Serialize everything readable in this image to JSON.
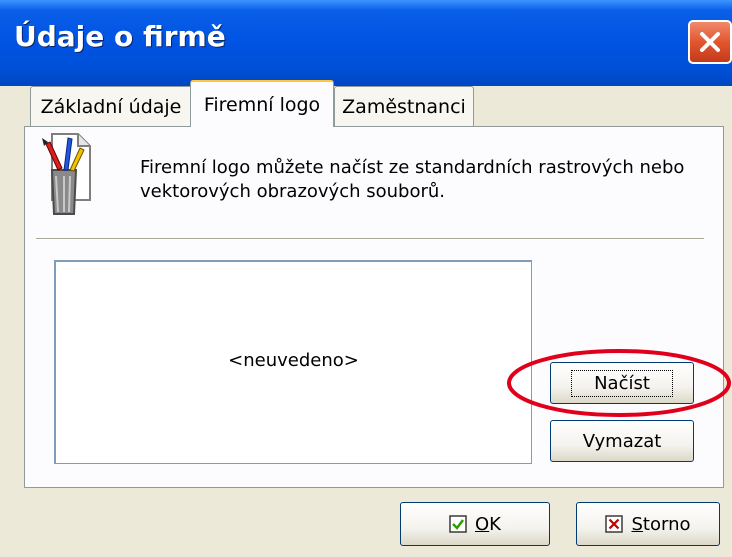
{
  "window": {
    "title": "Údaje o firmě",
    "close_icon": "close-icon"
  },
  "tabs": [
    {
      "label": "Základní údaje",
      "active": false
    },
    {
      "label": "Firemní logo",
      "active": true
    },
    {
      "label": "Zaměstnanci",
      "active": false
    }
  ],
  "panel": {
    "icon": "paint-tools-icon",
    "info_text": "Firemní logo můžete načíst ze standardních rastrových nebo vektorových obrazových souborů.",
    "logo_placeholder": "<neuvedeno>",
    "load_label": "Načíst",
    "clear_label": "Vymazat"
  },
  "footer": {
    "ok_mnemonic": "O",
    "ok_rest": "K",
    "cancel_mnemonic": "S",
    "cancel_rest": "torno"
  },
  "colors": {
    "titlebar": "#0054e3",
    "annotation": "#e0001b",
    "ok_check": "#2f9e00",
    "cancel_x": "#c00000"
  }
}
